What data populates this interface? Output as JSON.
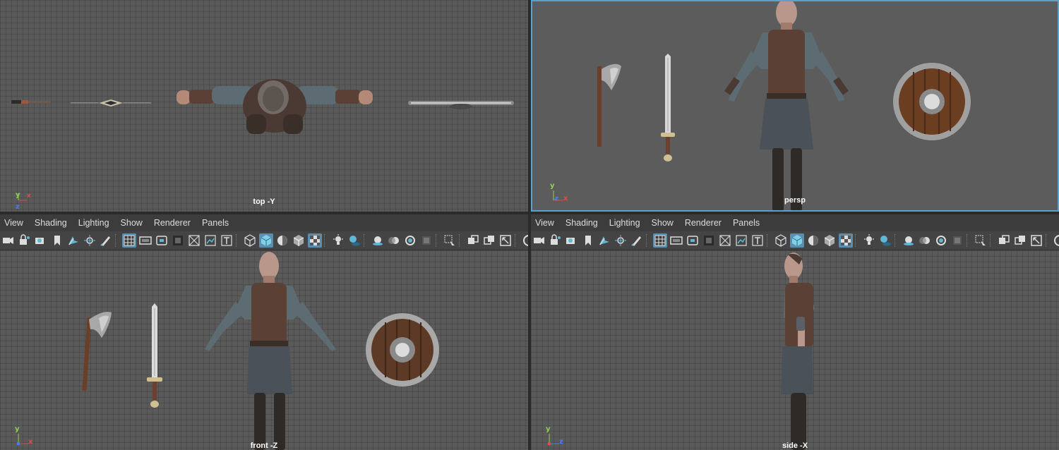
{
  "viewports": {
    "top": {
      "label": "top -Y",
      "axis": [
        "y",
        "x",
        "z"
      ]
    },
    "persp": {
      "label": "persp",
      "axis": [
        "y",
        "z",
        "x"
      ]
    },
    "front": {
      "label": "front -Z",
      "axis": [
        "y",
        "x"
      ]
    },
    "side": {
      "label": "side -X",
      "axis": [
        "y",
        "z"
      ]
    }
  },
  "panel_menu": [
    "View",
    "Shading",
    "Lighting",
    "Show",
    "Renderer",
    "Panels"
  ],
  "toolbar_icons": [
    "camera-icon",
    "lock-camera-icon",
    "camera-attributes-icon",
    "bookmark-icon",
    "image-plane-icon",
    "2d-pan-zoom-icon",
    "grease-pencil-icon",
    "sep",
    "grid-icon",
    "film-gate-icon",
    "resolution-gate-icon",
    "gate-mask-icon",
    "field-chart-icon",
    "safe-action-icon",
    "safe-title-icon",
    "sep",
    "wireframe-icon",
    "smooth-shade-all-icon",
    "default-material-icon",
    "wireframe-on-shaded-icon",
    "xray-icon",
    "sep",
    "use-default-lighting-icon",
    "shadows-icon",
    "sep",
    "screen-space-ambient-occlusion-icon",
    "motion-blur-icon",
    "multisample-aa-icon",
    "depth-of-field-icon",
    "sep",
    "isolate-select-icon",
    "sep",
    "xray-joints-icon",
    "xray-active-icon",
    "hud-icon",
    "sep",
    "exposure-icon"
  ],
  "colors": {
    "active_icon_bg": "#5b8fb0",
    "viewport_bg": "#5a5a5a",
    "menubar_bg": "#3c3c3c",
    "axis_y": "#8fd14f",
    "axis_x": "#e04b4b",
    "axis_z": "#4a7ef0"
  }
}
